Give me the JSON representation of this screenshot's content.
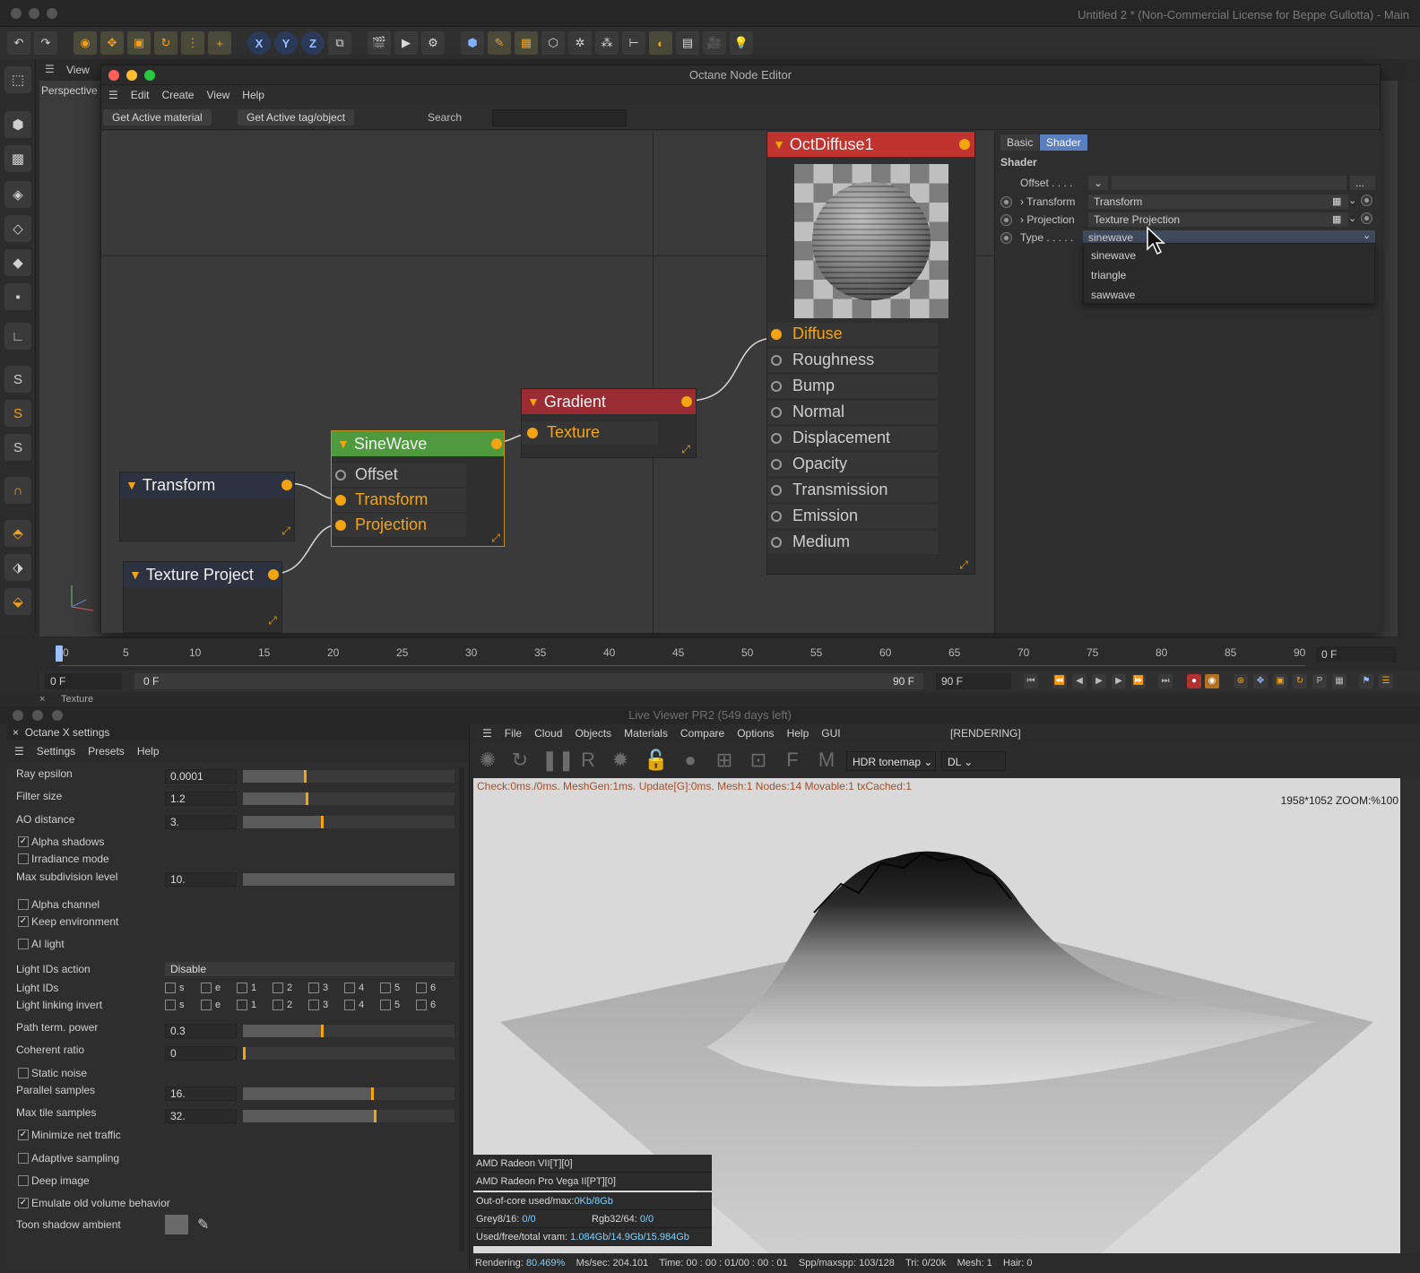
{
  "app": {
    "title": "Untitled 2 * (Non-Commercial License for Beppe Gullotta) - Main"
  },
  "viewport": {
    "menu_view": "View",
    "camera": "Perspective"
  },
  "node_editor": {
    "title": "Octane Node Editor",
    "menu": [
      "Edit",
      "Create",
      "View",
      "Help"
    ],
    "buttons": {
      "get_active_material": "Get Active material",
      "get_active_tag": "Get Active tag/object"
    },
    "search_label": "Search",
    "search_value": "",
    "nodes": {
      "transform": {
        "title": "Transform"
      },
      "texture_projection": {
        "title": "Texture Project"
      },
      "sinewave": {
        "title": "SineWave",
        "ports": [
          "Offset",
          "Transform",
          "Projection"
        ]
      },
      "gradient": {
        "title": "Gradient",
        "ports": [
          "Texture"
        ]
      },
      "octdiffuse": {
        "title": "OctDiffuse1",
        "ports": [
          "Diffuse",
          "Roughness",
          "Bump",
          "Normal",
          "Displacement",
          "Opacity",
          "Transmission",
          "Emission",
          "Medium"
        ]
      }
    },
    "inspector": {
      "tabs": [
        "Basic",
        "Shader"
      ],
      "section": "Shader",
      "offset_label": "Offset . . . .",
      "offset_more": "...",
      "transform_label": "Transform",
      "transform_value": "Transform",
      "projection_label": "Projection",
      "projection_value": "Texture Projection",
      "type_label": "Type . . . . .",
      "type_value": "sinewave",
      "type_options": [
        "sinewave",
        "triangle",
        "sawwave"
      ]
    },
    "colors": {
      "orange": "#f2a413",
      "diffuse_header": "#c0342f",
      "gradient_header": "#9a2d33",
      "sinewave_header": "#4f9a3e",
      "dark_header": "#2d3240"
    }
  },
  "timeline": {
    "ticks": [
      "0",
      "5",
      "10",
      "15",
      "20",
      "25",
      "30",
      "35",
      "40",
      "45",
      "50",
      "55",
      "60",
      "65",
      "70",
      "75",
      "80",
      "85",
      "90"
    ],
    "current_frame": "0 F",
    "start_field": "0 F",
    "range_start": "0 F",
    "range_end": "90 F",
    "end_field": "90 F"
  },
  "lower_tab": "Texture",
  "octane_settings": {
    "title": "Octane X settings",
    "menu": [
      "Settings",
      "Presets",
      "Help"
    ],
    "ray_epsilon": {
      "label": "Ray epsilon",
      "value": "0.0001",
      "fill": 0.3
    },
    "filter_size": {
      "label": "Filter size",
      "value": "1.2",
      "fill": 0.31
    },
    "ao_distance": {
      "label": "AO distance",
      "value": "3.",
      "fill": 0.38
    },
    "alpha_shadows": {
      "label": "Alpha shadows",
      "checked": true
    },
    "irradiance_mode": {
      "label": "Irradiance mode",
      "checked": false
    },
    "max_subdivision": {
      "label": "Max subdivision level",
      "value": "10.",
      "fill": 1.0
    },
    "alpha_channel": {
      "label": "Alpha channel",
      "checked": false
    },
    "keep_environment": {
      "label": "Keep environment",
      "checked": true
    },
    "ai_light": {
      "label": "AI light",
      "checked": false
    },
    "light_ids_action": {
      "label": "Light IDs action",
      "value": "Disable"
    },
    "light_ids": {
      "label": "Light IDs",
      "items": [
        "s",
        "e",
        "1",
        "2",
        "3",
        "4",
        "5",
        "6"
      ]
    },
    "light_linking_invert": {
      "label": "Light linking invert",
      "items": [
        "s",
        "e",
        "1",
        "2",
        "3",
        "4",
        "5",
        "6"
      ]
    },
    "path_term_power": {
      "label": "Path term. power",
      "value": "0.3",
      "fill": 0.38
    },
    "coherent_ratio": {
      "label": "Coherent ratio",
      "value": "0",
      "fill": 0.0
    },
    "static_noise": {
      "label": "Static noise",
      "checked": false
    },
    "parallel_samples": {
      "label": "Parallel samples",
      "value": "16.",
      "fill": 0.62
    },
    "max_tile_samples": {
      "label": "Max tile samples",
      "value": "32.",
      "fill": 0.63
    },
    "minimize_net_traffic": {
      "label": "Minimize net traffic",
      "checked": true
    },
    "adaptive_sampling": {
      "label": "Adaptive sampling",
      "checked": false
    },
    "deep_image": {
      "label": "Deep image",
      "checked": false
    },
    "emulate_old_volume": {
      "label": "Emulate old volume behavior",
      "checked": true
    },
    "toon_shadow_ambient": {
      "label": "Toon shadow ambient"
    }
  },
  "live_viewer": {
    "title": "Live Viewer PR2 (549 days left)",
    "menu": [
      "File",
      "Cloud",
      "Objects",
      "Materials",
      "Compare",
      "Options",
      "Help",
      "GUI"
    ],
    "status": "[RENDERING]",
    "tonemap": "HDR tonemap",
    "mode": "DL",
    "stats_line": "Check:0ms./0ms. MeshGen:1ms. Update[G]:0ms. Mesh:1 Nodes:14 Movable:1 txCached:1",
    "zoom": "1958*1052 ZOOM:%100",
    "gpu1": "AMD Radeon VII[T][0]",
    "gpu2": "AMD Radeon Pro Vega II[PT][0]",
    "out_of_core_label": "Out-of-core used/max:",
    "out_of_core_value": "0Kb/8Gb",
    "grey_label": "Grey8/16:",
    "grey_value": "0/0",
    "rgb_label": "Rgb32/64:",
    "rgb_value": "0/0",
    "vram_label": "Used/free/total vram:",
    "vram_value": "1.084Gb/14.9Gb/15.984Gb",
    "bottom": {
      "rendering_label": "Rendering:",
      "rendering_value": "80.469%",
      "mssec_label": "Ms/sec:",
      "mssec_value": "204.101",
      "time_label": "Time:",
      "time_value": "00 : 00 : 01/00 : 00 : 01",
      "spp_label": "Spp/maxspp:",
      "spp_value": "103/128",
      "tri_label": "Tri:",
      "tri_value": "0/20k",
      "mesh_label": "Mesh:",
      "mesh_value": "1",
      "hair_label": "Hair:",
      "hair_value": "0"
    }
  }
}
